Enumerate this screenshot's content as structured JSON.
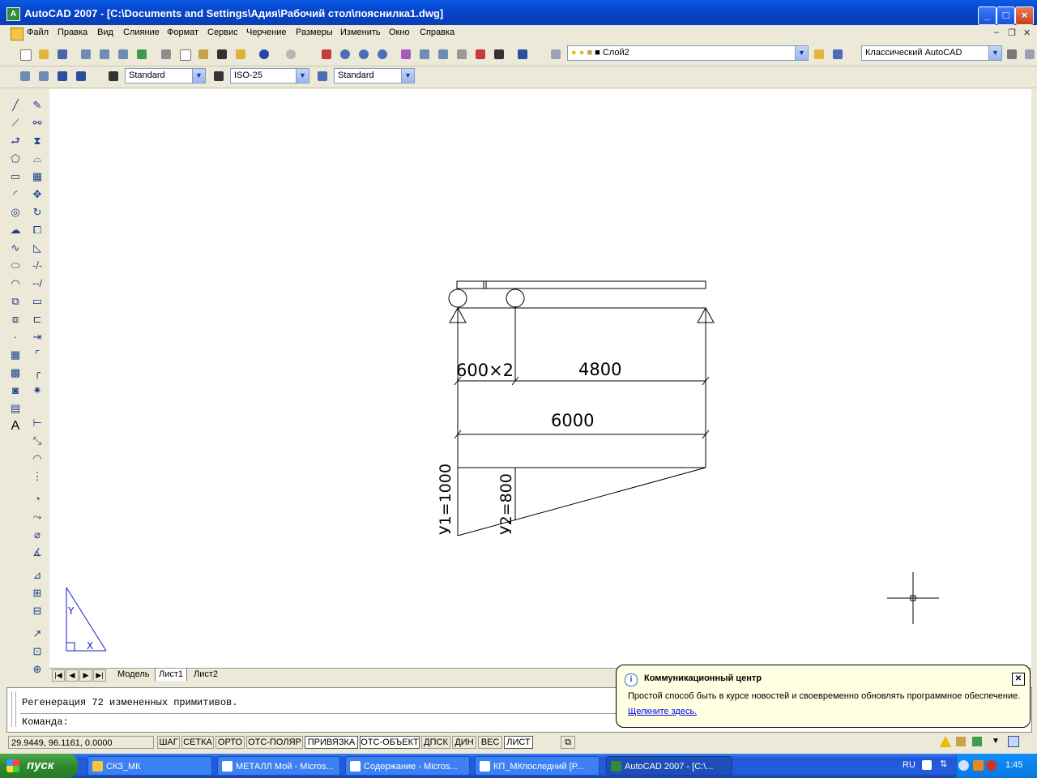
{
  "window": {
    "title": "AutoCAD 2007 - [C:\\Documents and Settings\\Адия\\Рабочий стол\\пояснилка1.dwg]",
    "controls": [
      "_",
      "□",
      "×"
    ]
  },
  "menu": [
    "Файл",
    "Правка",
    "Вид",
    "Слияние",
    "Формат",
    "Сервис",
    "Черчение",
    "Размеры",
    "Изменить",
    "Окно",
    "Справка"
  ],
  "toolbar": {
    "layer_combo": "Слой2",
    "workspace_combo": "Классический AutoCAD",
    "text_style": "Standard",
    "dim_style": "ISO-25",
    "table_style": "Standard"
  },
  "drawing": {
    "dim_left": "600×2",
    "dim_mid": "4800",
    "dim_total": "6000",
    "y1_label": "У1=1000",
    "y2_label": "У2=800",
    "ucs_y": "Y",
    "ucs_x": "X"
  },
  "layout_tabs": [
    "Модель",
    "Лист1",
    "Лист2"
  ],
  "command_window": {
    "line1": "Регенерация 72 измененных примитивов.",
    "line2": "Команда:"
  },
  "statusbar": {
    "coords": "29.9449, 96.1161, 0.0000",
    "buttons": [
      {
        "label": "ШАГ",
        "on": false
      },
      {
        "label": "СЕТКА",
        "on": false
      },
      {
        "label": "ОРТО",
        "on": false
      },
      {
        "label": "ОТС-ПОЛЯР",
        "on": false
      },
      {
        "label": "ПРИВЯЗКА",
        "on": true
      },
      {
        "label": "ОТС-ОБЪЕКТ",
        "on": true
      },
      {
        "label": "ДПСК",
        "on": false
      },
      {
        "label": "ДИН",
        "on": false
      },
      {
        "label": "ВЕС",
        "on": false
      },
      {
        "label": "ЛИСТ",
        "on": true
      }
    ]
  },
  "balloon": {
    "title": "Коммуникационный центр",
    "text": "Простой способ быть в курсе новостей и своевременно обновлять программное обеспечение.",
    "link": "Щелкните здесь."
  },
  "taskbar": {
    "start": "пуск",
    "tasks": [
      {
        "label": "СКЗ_МК",
        "active": false
      },
      {
        "label": "МЕТАЛЛ Мой - Micros...",
        "active": false
      },
      {
        "label": "Содержание - Micros...",
        "active": false
      },
      {
        "label": "КП_МКпоследний [Р...",
        "active": false
      },
      {
        "label": "AutoCAD 2007 - [C:\\...",
        "active": true
      }
    ],
    "lang": "RU",
    "clock": "1:45"
  },
  "colors": {
    "titlebar": "#0a5ae6",
    "taskbar": "#245edb",
    "start_button": "#2f8a2f",
    "ucs_icon": "#1a1acc",
    "balloon_bg": "#ffffe1"
  }
}
